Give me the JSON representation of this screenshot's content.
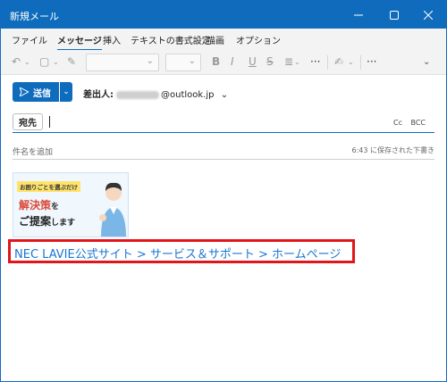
{
  "window": {
    "title": "新規メール"
  },
  "ribbon": {
    "tabs": [
      "ファイル",
      "メッセージ",
      "挿入",
      "テキストの書式設定",
      "描画",
      "オプション"
    ],
    "active": "メッセージ"
  },
  "toolbar": {
    "icons": [
      "undo-icon",
      "paste-icon",
      "format-painter-icon",
      "bold-icon",
      "italic-icon",
      "underline-icon",
      "strikethrough-icon",
      "line-spacing-icon",
      "more-icon",
      "editor-icon",
      "more-icon",
      "expand-icon"
    ]
  },
  "compose": {
    "send_label": "送信",
    "from_label": "差出人:",
    "from_domain": "@outlook.jp",
    "to_label": "宛先",
    "cc_label": "Cc",
    "bcc_label": "BCC",
    "subject_placeholder": "件名を追加",
    "saved_status": "6:43 に保存された下書き"
  },
  "body": {
    "banner": {
      "line1": "お困りごとを選ぶだけ",
      "line2": "解決策",
      "line2_suffix": "を",
      "line3": "ご提案",
      "line3_suffix": "します"
    },
    "link_text": "NEC LAVIE公式サイト > サービス＆サポート > ホームページ"
  },
  "colors": {
    "accent": "#0f6cbd",
    "highlight_border": "#e0161b",
    "link": "#1976d2"
  }
}
